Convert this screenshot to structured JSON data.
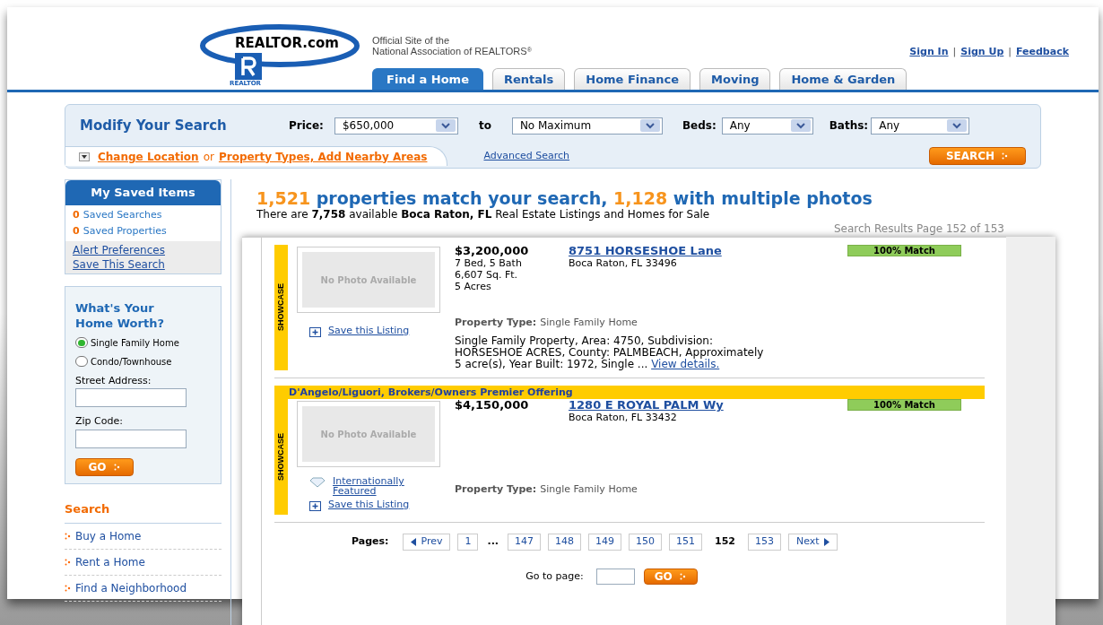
{
  "header": {
    "logo": {
      "brand": "REALTOR.com",
      "sub": "REALTOR"
    },
    "tagline": [
      "Official Site of the",
      "National Association of REALTORS"
    ],
    "registered_mark": "®",
    "user_links": [
      "Sign In",
      "Sign Up",
      "Feedback"
    ],
    "link_separator": "|",
    "tabs": [
      {
        "label": "Find a Home",
        "selected": true
      },
      {
        "label": "Rentals",
        "selected": false
      },
      {
        "label": "Home Finance",
        "selected": false
      },
      {
        "label": "Moving",
        "selected": false
      },
      {
        "label": "Home & Garden",
        "selected": false
      }
    ]
  },
  "search": {
    "title": "Modify Your Search",
    "price_label": "Price:",
    "price_min": "$650,000",
    "to_label": "to",
    "price_max": "No Maximum",
    "beds_label": "Beds:",
    "beds": "Any",
    "baths_label": "Baths:",
    "baths": "Any",
    "change_location": "Change Location",
    "or": "or",
    "property_types": "Property Types, Add Nearby Areas",
    "advanced_search": "Advanced Search",
    "search_button": "SEARCH"
  },
  "saved_items": {
    "title": "My Saved Items",
    "counts": [
      {
        "count": "0",
        "label": "Saved Searches"
      },
      {
        "count": "0",
        "label": "Saved Properties"
      }
    ],
    "links": [
      "Alert Preferences",
      "Save This Search"
    ]
  },
  "home_worth": {
    "title": "What's Your Home Worth?",
    "radios": [
      {
        "label": "Single Family Home",
        "selected": true
      },
      {
        "label": "Condo/Townhouse",
        "selected": false
      }
    ],
    "street_label": "Street Address:",
    "zip_label": "Zip Code:",
    "go_button": "GO"
  },
  "search_nav": {
    "title": "Search",
    "items": [
      "Buy a Home",
      "Rent a Home",
      "Find a Neighborhood"
    ]
  },
  "results": {
    "count": "1,521",
    "count_text": "properties match your search,",
    "photo_count": "1,128",
    "photo_text": "with multiple photos",
    "summary": "There are **7,758** available **Boca Raton, FL** Real Estate Listings and Homes for Sale",
    "page_info": "Search Results Page 152 of 153"
  },
  "listings": [
    {
      "badge": "SHOWCASE",
      "photo_text": "No Photo Available",
      "price": "$3,200,000",
      "details": [
        "7 Bed, 5 Bath",
        "6,607 Sq. Ft.",
        "5 Acres"
      ],
      "address": "8751 HORSESHOE Lane",
      "city": "Boca Raton, FL 33496",
      "match": "100% Match",
      "property_type_label": "Property Type:",
      "property_type": "Single Family Home",
      "description": "Single Family Property, Area: 4750, Subdivision: HORSESHOE ACRES, County: PALMBEACH, Approximately 5 acre(s), Year Built: 1972, Single ...",
      "view_details": "View details.",
      "actions": [
        {
          "kind": "save",
          "label": "Save this Listing"
        }
      ]
    },
    {
      "banner": "D'Angelo/Liguori, Brokers/Owners Premier Offering",
      "badge": "SHOWCASE",
      "photo_text": "No Photo Available",
      "price": "$4,150,000",
      "address": "1280 E ROYAL PALM Wy",
      "city": "Boca Raton, FL 33432",
      "match": "100% Match",
      "property_type_label": "Property Type:",
      "property_type": "Single Family Home",
      "actions": [
        {
          "kind": "featured",
          "label": "Internationally Featured"
        },
        {
          "kind": "save",
          "label": "Save this Listing"
        }
      ]
    }
  ],
  "pagination": {
    "label": "Pages:",
    "prev": "Prev",
    "next": "Next",
    "pages": [
      {
        "kind": "page",
        "label": "1",
        "selected": false
      },
      {
        "kind": "ellipsis",
        "label": "..."
      },
      {
        "kind": "page",
        "label": "147",
        "selected": false
      },
      {
        "kind": "page",
        "label": "148",
        "selected": false
      },
      {
        "kind": "page",
        "label": "149",
        "selected": false
      },
      {
        "kind": "page",
        "label": "150",
        "selected": false
      },
      {
        "kind": "page",
        "label": "151",
        "selected": false
      },
      {
        "kind": "page",
        "label": "152",
        "selected": true
      },
      {
        "kind": "page",
        "label": "153",
        "selected": false
      }
    ],
    "goto_label": "Go to page:",
    "go_button": "GO"
  }
}
